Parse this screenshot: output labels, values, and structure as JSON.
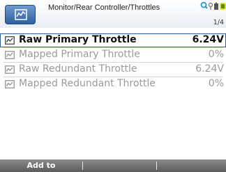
{
  "header": {
    "breadcrumb": "Monitor/Rear Controller/Throttles",
    "page_indicator": "1/4"
  },
  "list": {
    "items": [
      {
        "label": "Raw Primary Throttle",
        "value": "6.24V",
        "selected": true
      },
      {
        "label": "Mapped Primary Throttle",
        "value": "0%",
        "selected": false
      },
      {
        "label": "Raw Redundant Throttle",
        "value": "6.24V",
        "selected": false
      },
      {
        "label": "Mapped Redundant Throttle",
        "value": "0%",
        "selected": false
      }
    ],
    "item_icon": "parameter-graph-icon"
  },
  "footer": {
    "softkeys": [
      {
        "label": "Add to"
      },
      {
        "label": ""
      },
      {
        "label": ""
      }
    ]
  },
  "icons": {
    "app": "monitor-graph-icon",
    "status": [
      "search-icon",
      "key-icon",
      "battery-icon",
      "status-indicator-icon"
    ]
  },
  "colors": {
    "accent": "#2d5aa3",
    "selected_text": "#111111",
    "dimmed_text": "#9a9a9a",
    "footer_bg": "#6e6e6e"
  }
}
